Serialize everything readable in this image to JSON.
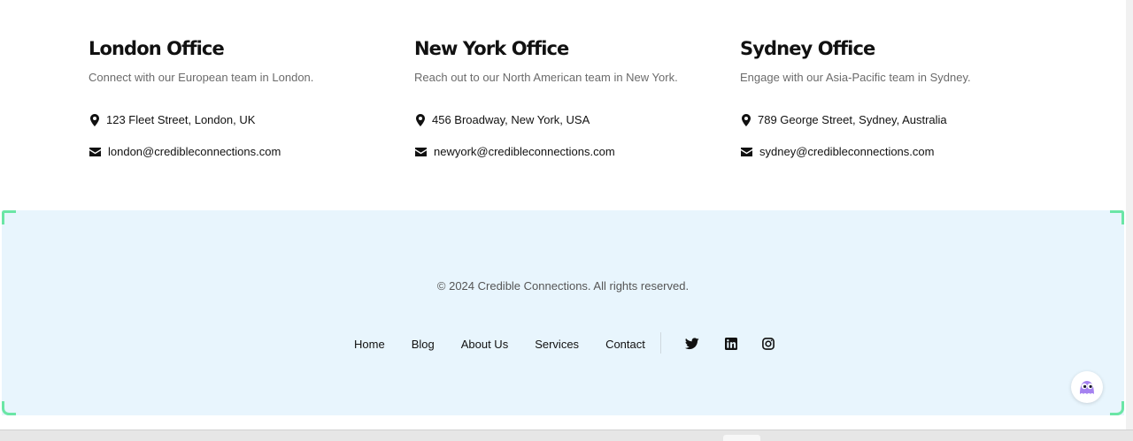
{
  "offices": [
    {
      "title": "London Office",
      "description": "Connect with our European team in London.",
      "address": "123 Fleet Street, London, UK",
      "email": "london@credibleconnections.com"
    },
    {
      "title": "New York Office",
      "description": "Reach out to our North American team in New York.",
      "address": "456 Broadway, New York, USA",
      "email": "newyork@credibleconnections.com"
    },
    {
      "title": "Sydney Office",
      "description": "Engage with our Asia-Pacific team in Sydney.",
      "address": "789 George Street, Sydney, Australia",
      "email": "sydney@credibleconnections.com"
    }
  ],
  "footer": {
    "copyright": "© 2024 Credible Connections. All rights reserved.",
    "nav": [
      "Home",
      "Blog",
      "About Us",
      "Services",
      "Contact"
    ],
    "social_icons": [
      "twitter-icon",
      "linkedin-icon",
      "instagram-icon"
    ]
  },
  "icons": {
    "address": "map-pin-icon",
    "email": "envelope-icon",
    "chat": "chat-assistant-icon"
  },
  "colors": {
    "footer_background": "#e8f5fd",
    "corner_accent": "#6be6a6",
    "assistant_accent": "#a582f0"
  }
}
